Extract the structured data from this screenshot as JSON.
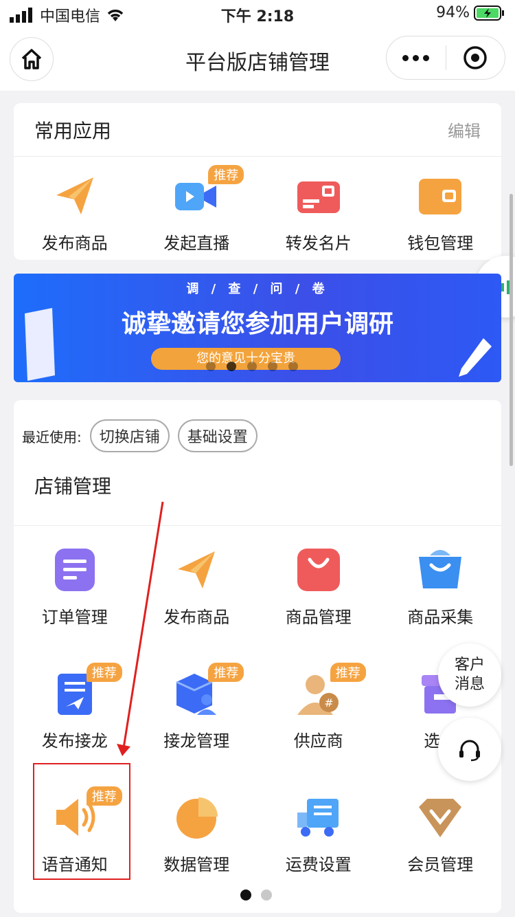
{
  "status": {
    "carrier": "中国电信",
    "time": "下午 2:18",
    "battery": "94%"
  },
  "nav": {
    "title": "平台版店铺管理"
  },
  "common": {
    "title": "常用应用",
    "edit": "编辑",
    "items": [
      {
        "label": "发布商品",
        "icon": "paper-plane-icon"
      },
      {
        "label": "发起直播",
        "icon": "video-camera-icon",
        "badge": "推荐"
      },
      {
        "label": "转发名片",
        "icon": "card-icon"
      },
      {
        "label": "钱包管理",
        "icon": "wallet-icon"
      }
    ]
  },
  "banner": {
    "subtitle": "调 / 查 / 问 / 卷",
    "headline": "诚挚邀请您参加用户调研",
    "pill": "您的意见十分宝贵"
  },
  "recent": {
    "label": "最近使用:",
    "chips": [
      "切换店铺",
      "基础设置"
    ]
  },
  "store": {
    "title": "店铺管理",
    "rows": [
      [
        {
          "label": "订单管理",
          "icon": "order-icon"
        },
        {
          "label": "发布商品",
          "icon": "paper-plane-icon"
        },
        {
          "label": "商品管理",
          "icon": "bag-icon"
        },
        {
          "label": "商品采集",
          "icon": "basket-icon"
        }
      ],
      [
        {
          "label": "发布接龙",
          "icon": "relay-doc-icon",
          "badge": "推荐"
        },
        {
          "label": "接龙管理",
          "icon": "box-user-icon",
          "badge": "推荐"
        },
        {
          "label": "供应商",
          "icon": "supplier-icon",
          "badge": "推荐"
        },
        {
          "label": "选品",
          "icon": "selection-icon"
        }
      ],
      [
        {
          "label": "语音通知",
          "icon": "speaker-icon",
          "badge": "推荐"
        },
        {
          "label": "数据管理",
          "icon": "pie-chart-icon"
        },
        {
          "label": "运费设置",
          "icon": "truck-icon"
        },
        {
          "label": "会员管理",
          "icon": "diamond-icon"
        }
      ]
    ]
  },
  "floats": {
    "message": [
      "客户",
      "消息"
    ]
  },
  "colors": {
    "orange": "#f5a341",
    "red": "#e02020",
    "blue": "#3c6cf5"
  }
}
